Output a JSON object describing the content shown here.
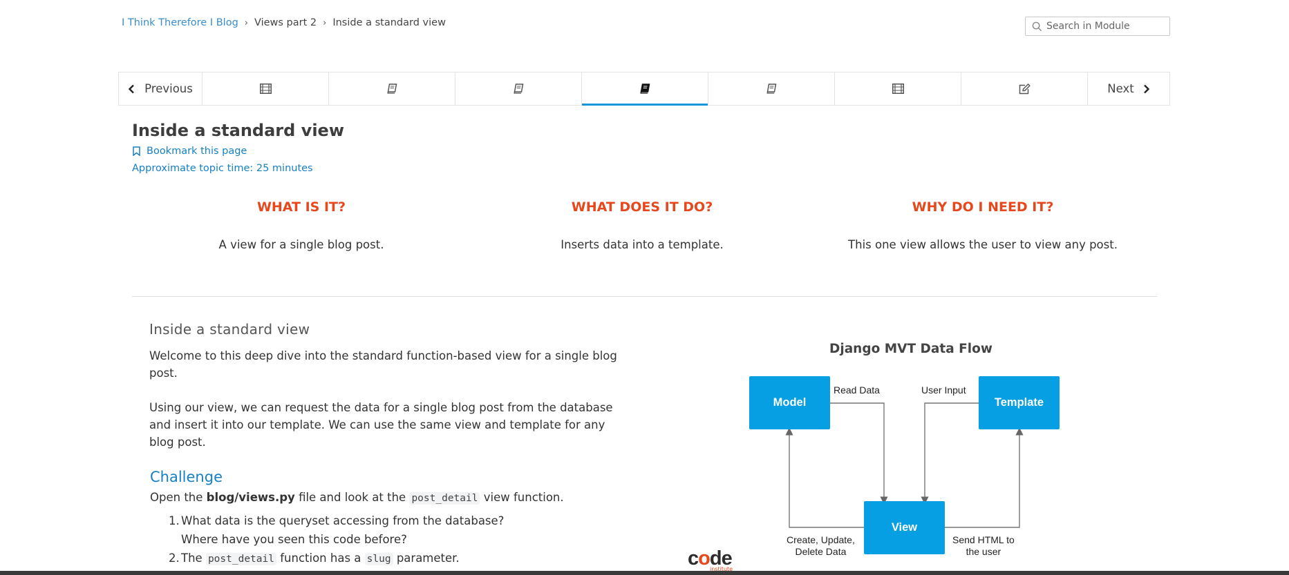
{
  "breadcrumb": {
    "course": "I Think Therefore I Blog",
    "section": "Views part 2",
    "current": "Inside a standard view"
  },
  "search": {
    "placeholder": "Search in Module"
  },
  "nav": {
    "previous_label": "Previous",
    "next_label": "Next",
    "steps": [
      {
        "icon": "film-icon",
        "active": false
      },
      {
        "icon": "book-icon",
        "active": false
      },
      {
        "icon": "book-icon",
        "active": false
      },
      {
        "icon": "book-icon",
        "active": true
      },
      {
        "icon": "book-icon",
        "active": false
      },
      {
        "icon": "film-icon",
        "active": false
      },
      {
        "icon": "edit-icon",
        "active": false
      }
    ]
  },
  "page": {
    "title": "Inside a standard view",
    "bookmark_label": "Bookmark this page",
    "topic_time": "Approximate topic time: 25 minutes"
  },
  "overview": {
    "what_heading": "WHAT IS IT?",
    "what_text": "A view for a single blog post.",
    "does_heading": "WHAT DOES IT DO?",
    "does_text": "Inserts data into a template.",
    "why_heading": "WHY DO I NEED IT?",
    "why_text": "This one view allows the user to view any post."
  },
  "lesson": {
    "heading": "Inside a standard view",
    "para1": "Welcome to this deep dive into the standard function-based view for a single blog post.",
    "para2": "Using our view, we can request the data for a single blog post from the database and insert it into our template. We can use the same view and template for any blog post.",
    "challenge_heading": "Challenge",
    "challenge_intro_pre": "Open the",
    "challenge_file": "blog/views.py",
    "challenge_intro_mid": "file and look at the",
    "challenge_code": "post_detail",
    "challenge_intro_post": "view function.",
    "item1_num": "1.",
    "item1_line1": "What data is the queryset accessing from the database?",
    "item1_line2": "Where have you seen this code before?",
    "item2_num": "2.",
    "item2_pre": "The",
    "item2_code1": "post_detail",
    "item2_mid": "function has a",
    "item2_code2": "slug",
    "item2_post": "parameter."
  },
  "diagram": {
    "title": "Django MVT Data Flow",
    "model": "Model",
    "template": "Template",
    "view": "View",
    "read_data": "Read Data",
    "user_input": "User Input",
    "cud_line1": "Create, Update,",
    "cud_line2": "Delete Data",
    "send_line1": "Send HTML to",
    "send_line2": "the user"
  },
  "footer": {
    "logo_c": "c",
    "logo_o": "o",
    "logo_de": "de",
    "logo_sub": "institute"
  },
  "colors": {
    "accent_blue": "#1694d9",
    "heading_orange": "#e8471c",
    "diagram_box": "#069fe4"
  }
}
